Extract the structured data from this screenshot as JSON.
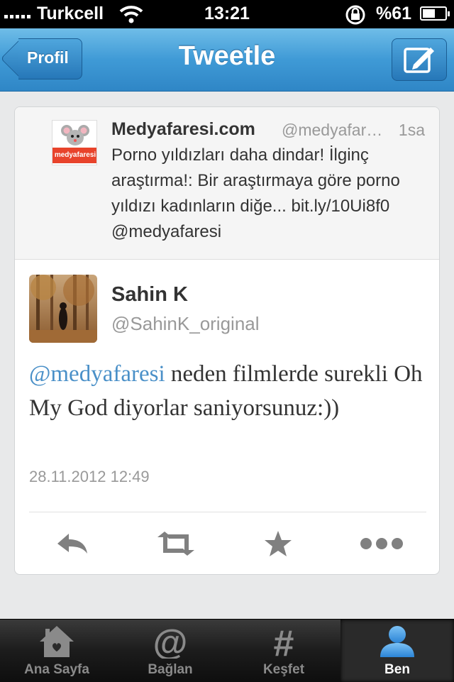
{
  "status_bar": {
    "carrier": "Turkcell",
    "time": "13:21",
    "battery": "%61",
    "battery_level": 0.61
  },
  "nav": {
    "back_label": "Profil",
    "title": "Tweetle"
  },
  "parent_tweet": {
    "name": "Medyafaresi.com",
    "handle": "@medyafar…",
    "age": "1sa",
    "text": "Porno yıldızları daha dindar! İlginç araştırma!: Bir araştırmaya göre porno yıldızı kadınların diğe... bit.ly/10Ui8f0 @medyafaresi",
    "avatar_logo": "medyafaresi"
  },
  "tweet": {
    "name": "Sahin K",
    "handle": "@SahinK_original",
    "mention": "@medyafaresi",
    "text": " neden filmlerde surekli  Oh My God diyorlar saniyorsunuz:))",
    "date": "28.11.2012 12:49"
  },
  "actions": [
    "reply-icon",
    "retweet-icon",
    "favorite-icon",
    "more-icon"
  ],
  "tabs": [
    {
      "label": "Ana Sayfa",
      "icon": "home-icon"
    },
    {
      "label": "Bağlan",
      "icon": "at-icon"
    },
    {
      "label": "Keşfet",
      "icon": "hash-icon"
    },
    {
      "label": "Ben",
      "icon": "person-icon"
    }
  ],
  "colors": {
    "nav_blue": "#3f9ad6",
    "link_blue": "#4a90c8",
    "active_tab_blue": "#3d9be6"
  }
}
